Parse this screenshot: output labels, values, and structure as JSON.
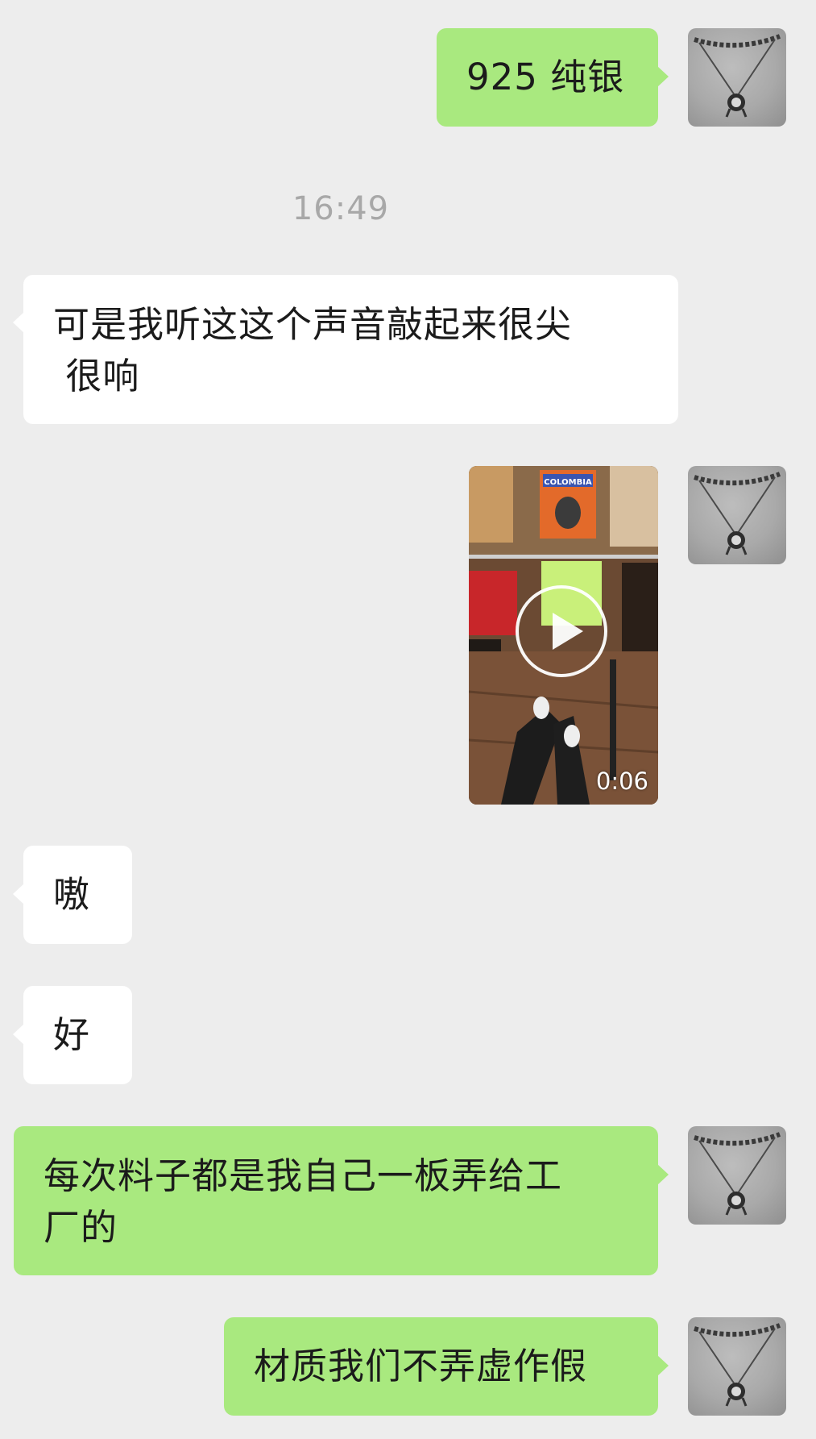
{
  "timestamp": "16:49",
  "video": {
    "duration": "0:06",
    "sign_text": "COLOMBIA"
  },
  "messages": [
    {
      "side": "self",
      "type": "text",
      "text": "925 纯银"
    },
    {
      "side": "other",
      "type": "text",
      "text": "可是我听这这个声音敲起来很尖\n 很响"
    },
    {
      "side": "self",
      "type": "video"
    },
    {
      "side": "other",
      "type": "text",
      "text": "嗷"
    },
    {
      "side": "other",
      "type": "text",
      "text": "好"
    },
    {
      "side": "self",
      "type": "text",
      "text": "每次料子都是我自己一板弄给工\n厂的"
    },
    {
      "side": "self",
      "type": "text",
      "text": "材质我们不弄虚作假"
    }
  ],
  "colors": {
    "background": "#ededed",
    "self_bubble": "#a9e97f",
    "other_bubble": "#ffffff",
    "timestamp": "#a8a8a8"
  },
  "icons": [
    "avatar-necklace-photo",
    "play-icon"
  ]
}
